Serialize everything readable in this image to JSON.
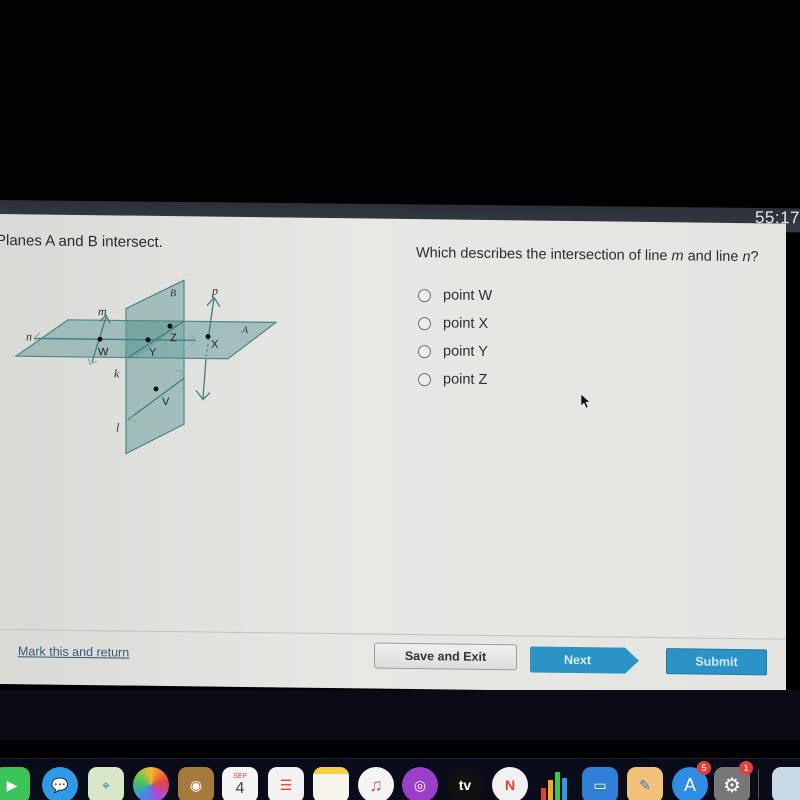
{
  "timer": "55:17",
  "question": {
    "prompt": "Planes A and B intersect.",
    "text_before": "Which describes the intersection of line ",
    "var1": "m",
    "text_middle": " and line ",
    "var2": "n",
    "text_after": "?",
    "options": [
      {
        "label": "point W",
        "selected": false
      },
      {
        "label": "point X",
        "selected": false
      },
      {
        "label": "point Y",
        "selected": false
      },
      {
        "label": "point Z",
        "selected": false
      }
    ]
  },
  "diagram": {
    "plane_labels": [
      "A",
      "B"
    ],
    "line_labels": [
      "m",
      "n",
      "k",
      "l",
      "p"
    ],
    "point_labels": [
      "W",
      "X",
      "Y",
      "Z",
      "V"
    ],
    "plane_color": "#6fa3a1",
    "line_color": "#3e7e80"
  },
  "footer": {
    "mark_link": "Mark this and return",
    "save_exit": "Save and Exit",
    "next": "Next",
    "submit": "Submit",
    "accent": "#2c93c7"
  },
  "dock": {
    "items": [
      {
        "name": "FaceTime",
        "badge": null
      },
      {
        "name": "Messages",
        "badge": null
      },
      {
        "name": "Maps",
        "badge": null
      },
      {
        "name": "Photos",
        "badge": null
      },
      {
        "name": "Contacts",
        "badge": null
      },
      {
        "name": "Calendar",
        "month": "SEP",
        "day": "4",
        "badge": null
      },
      {
        "name": "Reminders",
        "badge": null
      },
      {
        "name": "Notes",
        "badge": null
      },
      {
        "name": "Music",
        "badge": null
      },
      {
        "name": "Podcasts",
        "badge": null
      },
      {
        "name": "TV",
        "label": "tv",
        "badge": null
      },
      {
        "name": "News",
        "badge": null
      },
      {
        "name": "Numbers",
        "badge": null
      },
      {
        "name": "Keynote",
        "badge": null
      },
      {
        "name": "Pages",
        "badge": null
      },
      {
        "name": "App Store",
        "badge": "5"
      },
      {
        "name": "System Preferences",
        "badge": "1"
      },
      {
        "name": "Preview",
        "badge": null
      }
    ]
  }
}
